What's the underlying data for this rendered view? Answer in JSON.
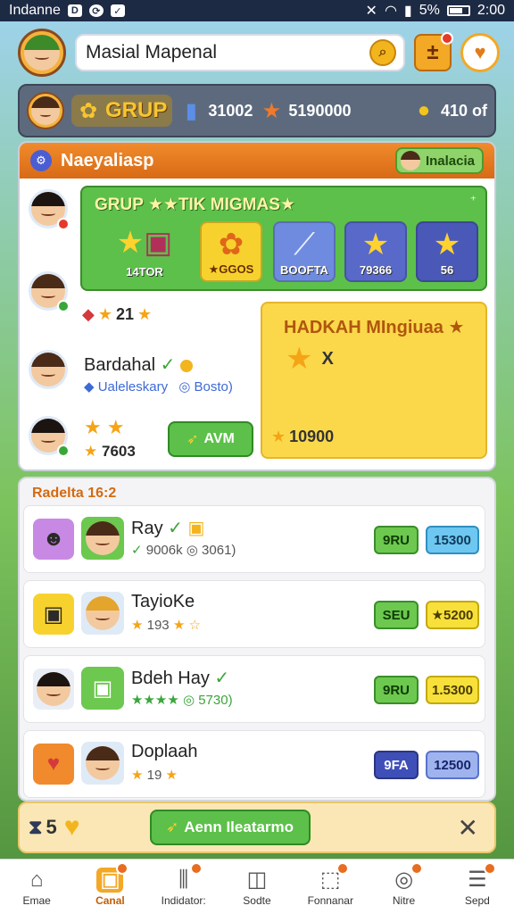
{
  "status_bar": {
    "carrier": "Indanne",
    "battery_text": "5%",
    "time": "2:00"
  },
  "top_bar": {
    "search_value": "Masial Mapenal"
  },
  "currency_bar": {
    "group_label": "GRUP",
    "values": [
      "31002",
      "5190000",
      "410 of"
    ]
  },
  "panel": {
    "header_title": "Naeyaliasp",
    "header_button": "Inalacia",
    "green_card": {
      "title": "GRUP ★★TIK MIGMAS★",
      "more": "⁺",
      "tiles": [
        {
          "label": "14TOR",
          "icon": "star-icon"
        },
        {
          "label": "★GGOS",
          "icon": "fox-mascot-icon"
        },
        {
          "label": "BOOFTA",
          "icon": "sword-icon"
        },
        {
          "label": "79366",
          "icon": "star-icon"
        },
        {
          "label": "56",
          "icon": "star-badge-icon"
        }
      ]
    },
    "stat_value": "21",
    "yellow_card": {
      "title": "HADKAH MIngiuaa",
      "multiplier": "X",
      "amount": "10900"
    },
    "profile": {
      "name": "Bardahal",
      "sub_left": "Ualeleskary",
      "sub_right": "Bosto)"
    },
    "bottom_left_amount": "7603",
    "cta_label": "AVM"
  },
  "list": {
    "title": "Radelta 16:2",
    "rows": [
      {
        "name": "Ray",
        "sub": "9006k  ◎ 3061)",
        "pill_a": "9RU",
        "pill_b": "15300"
      },
      {
        "name": "TayioKe",
        "sub": "193",
        "pill_a": "SEU",
        "pill_b": "★5200"
      },
      {
        "name": "Bdeh Hay",
        "sub": "★★★★  ◎ 5730)",
        "pill_a": "9RU",
        "pill_b": "1.5300"
      },
      {
        "name": "Doplaah",
        "sub": "19",
        "pill_a": "9FA",
        "pill_b": "12500"
      }
    ]
  },
  "action_bar": {
    "counter": "5",
    "cta_label": "Aenn Ileatarmo",
    "close": "✕"
  },
  "nav": [
    {
      "label": "Emae",
      "icon": "home-icon"
    },
    {
      "label": "Canal",
      "icon": "chest-icon"
    },
    {
      "label": "Indidator:",
      "icon": "bars-icon"
    },
    {
      "label": "Sodte",
      "icon": "cup-icon"
    },
    {
      "label": "Fonnanar",
      "icon": "box-icon"
    },
    {
      "label": "Nitre",
      "icon": "target-icon"
    },
    {
      "label": "Sepd",
      "icon": "layers-icon"
    }
  ],
  "colors": {
    "accent_orange": "#f18b2c",
    "accent_green": "#5cc04a",
    "accent_gold": "#f2b51d",
    "panel_slate": "#5d6a7e"
  }
}
